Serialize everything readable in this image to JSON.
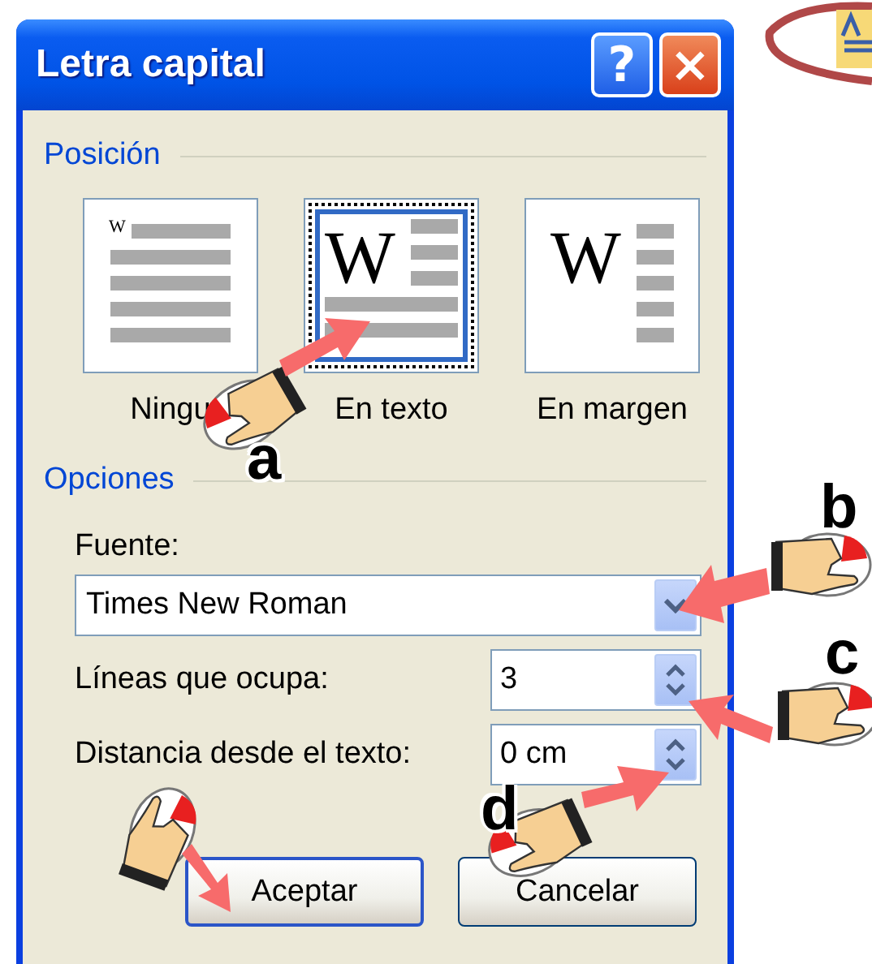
{
  "window": {
    "title": "Letra capital",
    "help_button": "?",
    "close_button": "×"
  },
  "position": {
    "legend": "Posición",
    "options": [
      {
        "kind": "none",
        "glyph": "W",
        "label": "Ningu",
        "selected": false
      },
      {
        "kind": "in-text",
        "glyph": "W",
        "label": "En texto",
        "selected": true
      },
      {
        "kind": "in-margin",
        "glyph": "W",
        "label": "En margen",
        "selected": false
      }
    ]
  },
  "options": {
    "legend": "Opciones",
    "font": {
      "label": "Fuente:",
      "value": "Times New Roman"
    },
    "lines": {
      "label": "Líneas que ocupa:",
      "value": "3"
    },
    "distance": {
      "label": "Distancia desde el texto:",
      "value": "0 cm"
    }
  },
  "buttons": [
    {
      "label": "Aceptar",
      "default": true
    },
    {
      "label": "Cancelar",
      "default": false
    }
  ],
  "annotations": [
    {
      "letter": "a"
    },
    {
      "letter": "b"
    },
    {
      "letter": "c"
    },
    {
      "letter": "d"
    }
  ]
}
